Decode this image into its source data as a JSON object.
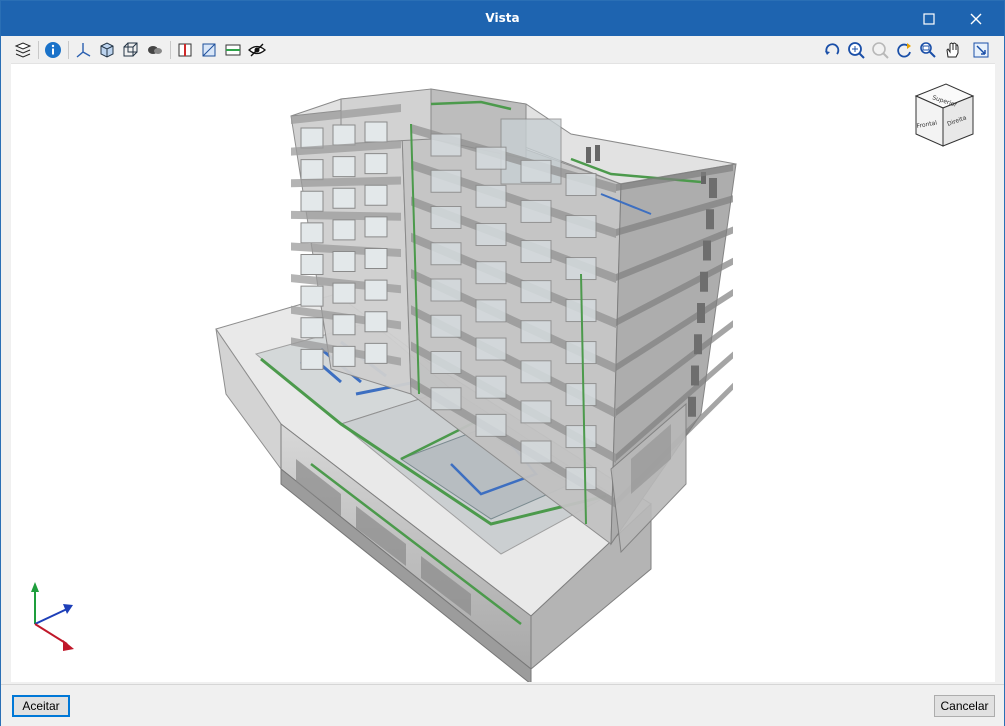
{
  "window": {
    "title": "Vista"
  },
  "toolbar": {
    "left_icons": [
      "layers-icon",
      "info-icon",
      "axes-icon",
      "solid-view-icon",
      "wireframe-view-icon",
      "hide-elements-icon",
      "section-plane-icon",
      "clip-box-icon",
      "floor-plan-icon",
      "visibility-eye-icon"
    ],
    "right_icons": [
      "rotate-view-icon",
      "zoom-extents-icon",
      "zoom-previous-icon",
      "refresh-view-icon",
      "zoom-window-icon",
      "pan-hand-icon",
      "fit-window-icon"
    ]
  },
  "viewcube": {
    "top_label": "Superior",
    "front_label": "Frontal",
    "right_label": "Direita"
  },
  "footer": {
    "accept_label": "Aceitar",
    "cancel_label": "Cancelar"
  },
  "colors": {
    "title_bar": "#1e64b0",
    "axis_x": "#c0182a",
    "axis_y": "#1e9e3c",
    "axis_z": "#1d3fb8"
  }
}
